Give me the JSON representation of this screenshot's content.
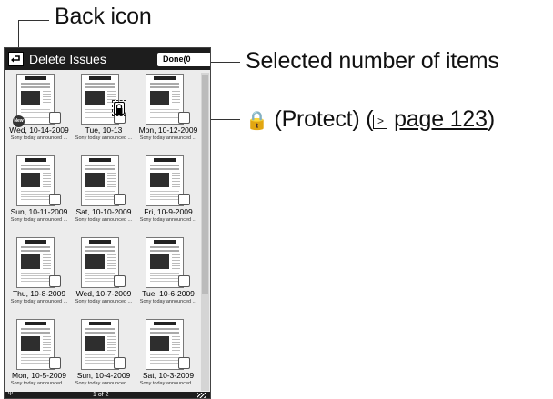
{
  "callouts": {
    "back": "Back icon",
    "selected": "Selected number of items",
    "protect_icon": "🔒",
    "protect": "(Protect) (",
    "page_ref": "page 123",
    "protect_end": ")"
  },
  "screen": {
    "title": "Delete Issues",
    "done_label": "Done(0",
    "page_indicator": "1 of 2",
    "status_left": "Ψ",
    "new_badge": "New"
  },
  "issues": [
    {
      "date": "Wed, 10-14-2009",
      "desc": "Sony today announced ...",
      "new": true
    },
    {
      "date": "Tue, 10-13",
      "desc": "Sony today announced ...",
      "locked": true
    },
    {
      "date": "Mon, 10-12-2009",
      "desc": "Sony today announced ..."
    },
    {
      "date": "Sun, 10-11-2009",
      "desc": "Sony today announced ..."
    },
    {
      "date": "Sat, 10-10-2009",
      "desc": "Sony today announced ..."
    },
    {
      "date": "Fri, 10-9-2009",
      "desc": "Sony today announced ..."
    },
    {
      "date": "Thu, 10-8-2009",
      "desc": "Sony today announced ..."
    },
    {
      "date": "Wed, 10-7-2009",
      "desc": "Sony today announced ..."
    },
    {
      "date": "Tue, 10-6-2009",
      "desc": "Sony today announced ..."
    },
    {
      "date": "Mon, 10-5-2009",
      "desc": "Sony today announced ..."
    },
    {
      "date": "Sun, 10-4-2009",
      "desc": "Sony today announced ..."
    },
    {
      "date": "Sat, 10-3-2009",
      "desc": "Sony today announced ..."
    }
  ]
}
